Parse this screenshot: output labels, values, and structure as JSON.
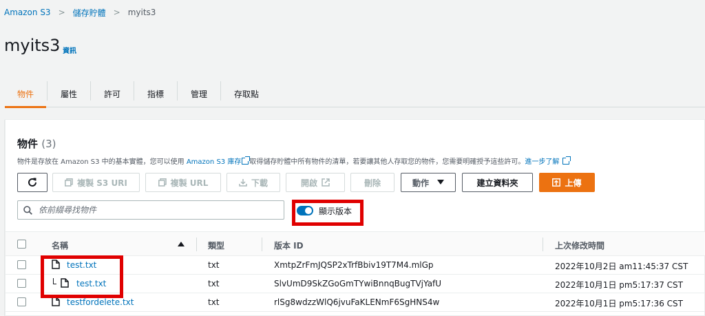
{
  "breadcrumb": {
    "items": [
      "Amazon S3",
      "儲存貯體",
      "myits3"
    ]
  },
  "page": {
    "title": "myits3",
    "info_link": "資訊"
  },
  "tabs": [
    {
      "label": "物件",
      "active": true
    },
    {
      "label": "屬性",
      "active": false
    },
    {
      "label": "許可",
      "active": false
    },
    {
      "label": "指標",
      "active": false
    },
    {
      "label": "管理",
      "active": false
    },
    {
      "label": "存取點",
      "active": false
    }
  ],
  "objects_panel": {
    "title": "物件",
    "count": "(3)",
    "description": {
      "part1": "物件是存放在 Amazon S3 中的基本實體，您可以使用 ",
      "link1": "Amazon S3 庫存",
      "part2": "取得儲存貯體中所有物件的清單，若要讓其他人存取您的物件，您需要明確授予這些許可。",
      "link2": "進一步了解"
    }
  },
  "toolbar": {
    "copy_s3_uri": "複製 S3 URI",
    "copy_url": "複製 URL",
    "download": "下載",
    "open": "開啟",
    "delete": "刪除",
    "actions": "動作",
    "create_folder": "建立資料夾",
    "upload": "上傳"
  },
  "search": {
    "placeholder": "依前綴尋找物件"
  },
  "versions_toggle": {
    "label": "顯示版本",
    "on": true
  },
  "table": {
    "columns": {
      "name": "名稱",
      "type": "類型",
      "version_id": "版本 ID",
      "last_modified": "上次修改時間"
    },
    "rows": [
      {
        "name": "test.txt",
        "type": "txt",
        "version_id": "XmtpZrFmJQSP2xTrfBbiv19T7M4.mlGp",
        "last_modified": "2022年10月2日 am11:45:37 CST"
      },
      {
        "name": "test.txt",
        "type": "txt",
        "version_id": "SlvUmD9SkZGoGmTYwiBnnqBugTVjYafU",
        "last_modified": "2022年10月1日 pm5:17:37 CST"
      },
      {
        "name": "testfordelete.txt",
        "type": "txt",
        "version_id": "rlSg8wdzzWlQ6jvuFaKLENmF6SgHNS4w",
        "last_modified": "2022年10月1日 pm5:17:36 CST"
      }
    ]
  },
  "colors": {
    "accent": "#ec7211",
    "link": "#0073bb",
    "highlight": "#e00000"
  }
}
